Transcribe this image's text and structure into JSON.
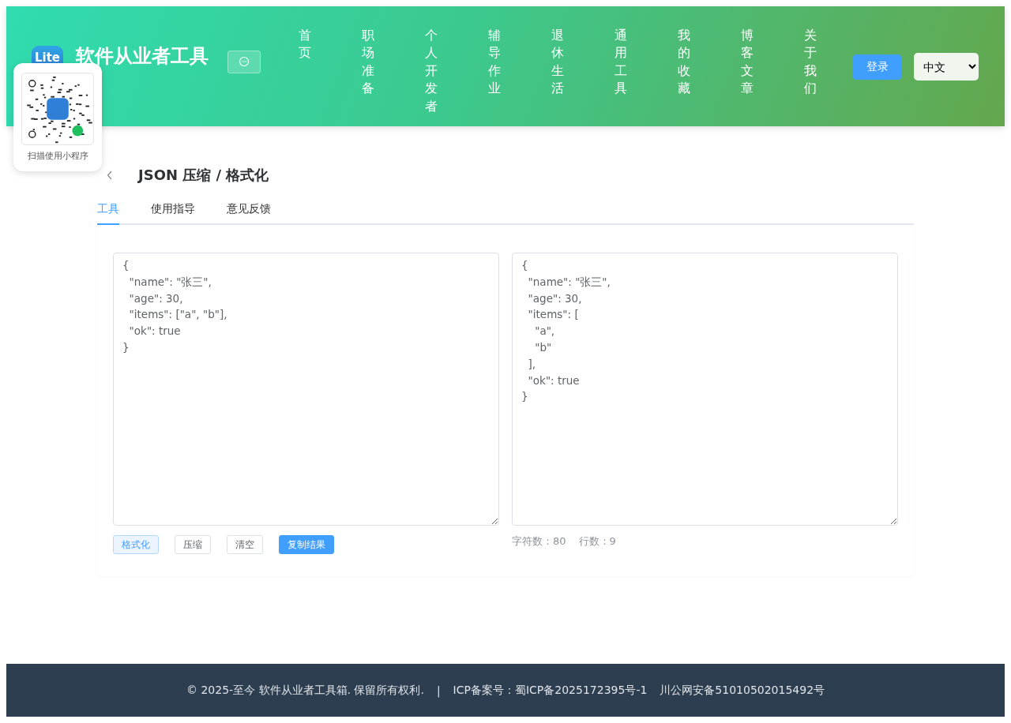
{
  "header": {
    "logo_text": "Lite",
    "site_title": "软件从业者工具",
    "nav": [
      {
        "label": "首页"
      },
      {
        "label": "职场准备"
      },
      {
        "label": "个人开发者"
      },
      {
        "label": "辅导作业"
      },
      {
        "label": "退休生活"
      },
      {
        "label": "通用工具"
      },
      {
        "label": "我的收藏"
      },
      {
        "label": "博客文章"
      },
      {
        "label": "关于我们"
      }
    ],
    "login_button": "登录",
    "language": "中文"
  },
  "qr_popup": {
    "caption": "扫描使用小程序"
  },
  "page": {
    "title": "JSON 压缩 / 格式化",
    "tabs": [
      {
        "label": "工具",
        "selected": true
      },
      {
        "label": "使用指导",
        "selected": false
      },
      {
        "label": "意见反馈",
        "selected": false
      }
    ],
    "input": "{\n  \"name\": \"张三\",\n  \"age\": 30,\n  \"items\": [\"a\", \"b\"],\n  \"ok\": true\n}",
    "output": "{\n  \"name\": \"张三\",\n  \"age\": 30,\n  \"items\": [\n    \"a\",\n    \"b\"\n  ],\n  \"ok\": true\n}",
    "buttons": [
      {
        "label": "格式化",
        "kind": "light"
      },
      {
        "label": "压缩",
        "kind": "plain"
      },
      {
        "label": "清空",
        "kind": "plain"
      },
      {
        "label": "复制结果",
        "kind": "primary"
      }
    ],
    "stats": [
      {
        "label": "字符数：80"
      },
      {
        "label": "行数：9"
      }
    ]
  },
  "footer": {
    "copyright": "© 2025-至今 软件从业者工具箱. 保留所有权利.",
    "separator": "|",
    "icp": "ICP备案号：蜀ICP备2025172395号-1",
    "police": "川公网安备51010502015492号"
  }
}
